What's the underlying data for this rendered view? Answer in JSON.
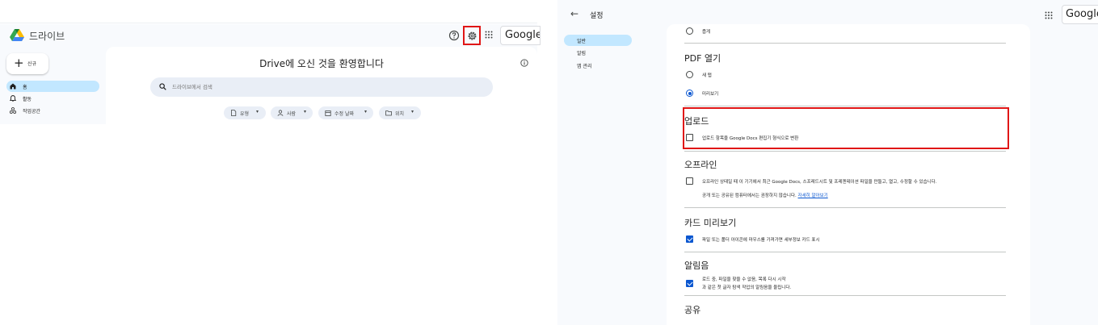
{
  "drive": {
    "app_title": "드라이브",
    "brand": "Google",
    "new_button": "신규",
    "nav": [
      {
        "label": "홈",
        "icon": "home-icon",
        "active": true
      },
      {
        "label": "활동",
        "icon": "bell-icon",
        "active": false
      },
      {
        "label": "작업공간",
        "icon": "workspaces-icon",
        "active": false
      }
    ],
    "welcome": "Drive에 오신 것을 환영합니다",
    "search_placeholder": "드라이브에서 검색",
    "chips": [
      {
        "label": "유형",
        "icon": "file-icon"
      },
      {
        "label": "사람",
        "icon": "person-icon"
      },
      {
        "label": "수정 날짜",
        "icon": "calendar-icon"
      },
      {
        "label": "위치",
        "icon": "folder-icon"
      }
    ]
  },
  "settings": {
    "title": "설정",
    "brand": "Google",
    "nav": [
      {
        "label": "일반",
        "active": true
      },
      {
        "label": "알림",
        "active": false
      },
      {
        "label": "앱 관리",
        "active": false
      }
    ],
    "top_partial_option": "좁게",
    "pdf": {
      "title": "PDF 열기",
      "options": [
        {
          "label": "새 탭",
          "checked": false
        },
        {
          "label": "미리보기",
          "checked": true
        }
      ]
    },
    "upload": {
      "title": "업로드",
      "option": "업로드 항목을 Google Docs 편집기 형식으로 변환",
      "checked": false
    },
    "offline": {
      "title": "오프라인",
      "option": "오프라인 상태일 때 이 기기에서 최근 Google Docs, 스프레드시트 및 프레젠테이션 파일을 만들고, 열고, 수정할 수 있습니다.",
      "note": "공개 또는 공유된 컴퓨터에서는 권장하지 않습니다.",
      "link": "자세히 알아보기",
      "checked": false
    },
    "card_preview": {
      "title": "카드 미리보기",
      "option": "파일 또는 폴더 아이콘에 마우스를 가져가면 세부정보 카드 표시",
      "checked": true
    },
    "sounds": {
      "title": "알림음",
      "option_line1": "로드 중, 파일을 찾을 수 없음, 목록 다시 시작",
      "option_line2": "과 같은 첫 글자 탐색 작업의 알림음을 울립니다.",
      "checked": true
    },
    "sharing": {
      "title": "공유"
    }
  },
  "colors": {
    "accent": "#0b57d0",
    "highlight_box": "#e01616",
    "active_nav": "#c2e7ff"
  }
}
